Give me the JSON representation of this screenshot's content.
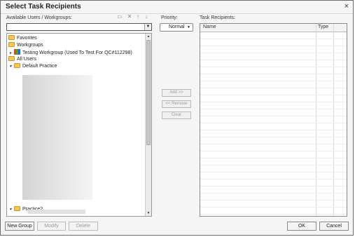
{
  "dialog": {
    "title": "Select Task Recipients",
    "close_glyph": "×"
  },
  "left_panel": {
    "label": "Available Users / Workgroups:",
    "combo_value": "",
    "toolbar_icons": [
      "new-workgroup-icon",
      "delete-icon",
      "move-up-icon",
      "move-down-icon"
    ],
    "tree": {
      "favorites": "Favorites",
      "workgroups": "Workgroups",
      "testing_workgroup": "Testing Workgroup (Used To Test For QC#112298)",
      "all_users": "All Users",
      "default_practice": "Default Practice",
      "practice2": "Practice2"
    }
  },
  "priority": {
    "label": "Priority:",
    "value": "Normal"
  },
  "middle_buttons": {
    "add": "Add >>",
    "remove": "<< Remove",
    "clear": "Clear"
  },
  "recipients": {
    "label": "Task Recipients:",
    "columns": [
      "Name",
      "Type"
    ],
    "rows": []
  },
  "footer": {
    "new_group": "New Group",
    "modify": "Modify",
    "delete": "Delete",
    "ok": "OK",
    "cancel": "Cancel"
  }
}
